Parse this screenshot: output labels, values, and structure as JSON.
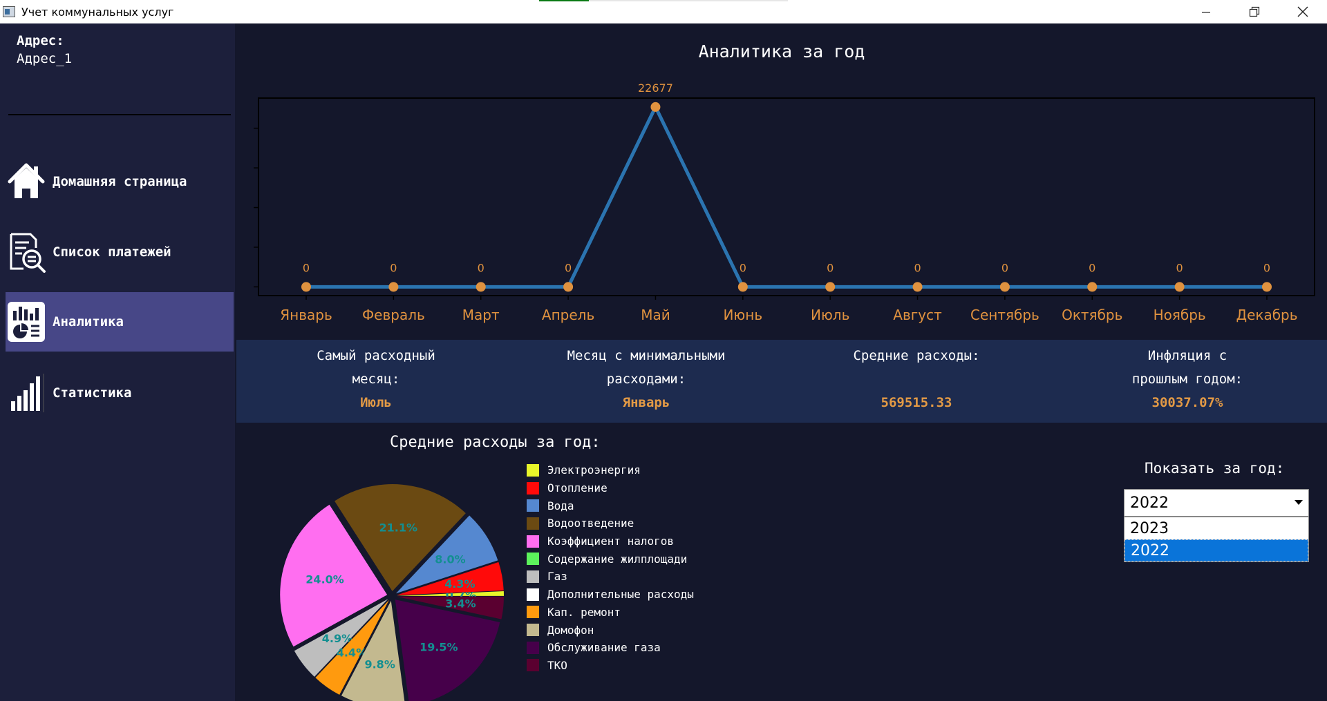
{
  "window": {
    "title": "Учет коммунальных услуг",
    "progress": 0.2
  },
  "sidebar": {
    "address_label": "Адрес:",
    "address_value": "Адрес_1",
    "items": [
      {
        "label": "Домашняя страница",
        "icon": "home-icon"
      },
      {
        "label": "Список платежей",
        "icon": "payments-list-icon"
      },
      {
        "label": "Аналитика",
        "icon": "analytics-icon",
        "active": true
      },
      {
        "label": "Статистика",
        "icon": "statistics-icon"
      }
    ]
  },
  "main": {
    "title": "Аналитика за год",
    "stats": [
      {
        "label": "Самый расходный месяц:",
        "value": "Июль"
      },
      {
        "label": "Месяц с минимальными расходами:",
        "value": "Январь"
      },
      {
        "label": "Средние расходы:",
        "value": "569515.33"
      },
      {
        "label": "Инфляция с прошлым годом:",
        "value": "30037.07%"
      }
    ],
    "year_picker": {
      "label": "Показать за год:",
      "selected": "2022",
      "options": [
        "2023",
        "2022"
      ]
    }
  },
  "chart_data": [
    {
      "type": "line",
      "title": "Аналитика за год",
      "categories": [
        "Январь",
        "Февраль",
        "Март",
        "Апрель",
        "Май",
        "Июнь",
        "Июль",
        "Август",
        "Сентябрь",
        "Октябрь",
        "Ноябрь",
        "Декабрь"
      ],
      "series": [
        {
          "values": [
            0,
            0,
            0,
            0,
            22677,
            0,
            0,
            0,
            0,
            0,
            0,
            0
          ],
          "color": "#1f77b4"
        }
      ],
      "point_label_color": "#e0923f",
      "ylim": [
        -1100,
        23800
      ],
      "grid": false,
      "colors": {
        "line": "#2b74b0",
        "marker": "#e0923f",
        "tick_label": "#e0923f",
        "axes": "#000000"
      }
    },
    {
      "type": "pie",
      "title": "Средние расходы за год:",
      "labels": [
        "Электроэнергия",
        "Отопление",
        "Вода",
        "Водоотведение",
        "Коэффициент налогов",
        "Содержание жилплощади",
        "Газ",
        "Дополнительные расходы",
        "Кап. ремонт",
        "Домофон",
        "Обслуживание газа",
        "ТКО"
      ],
      "values": [
        0.7,
        4.3,
        8.0,
        21.1,
        24.0,
        0.0,
        4.9,
        0.0,
        4.4,
        9.8,
        19.5,
        3.4
      ],
      "pct_labels": [
        "0.7%",
        "4.3%",
        "8.0%",
        "21.1%",
        "24.0%",
        "",
        "4.9%",
        "",
        "4.4%",
        "9.8%",
        "19.5%",
        "3.4%"
      ],
      "colors": [
        "#e8f52a",
        "#ff0a0a",
        "#5588d0",
        "#6b4a12",
        "#ff6ef0",
        "#5cf25c",
        "#bebebe",
        "#ffffff",
        "#ff9a0e",
        "#c3b98f",
        "#46004a",
        "#5a0030"
      ],
      "label_color": "#138f91",
      "legend_placement": "right"
    }
  ]
}
